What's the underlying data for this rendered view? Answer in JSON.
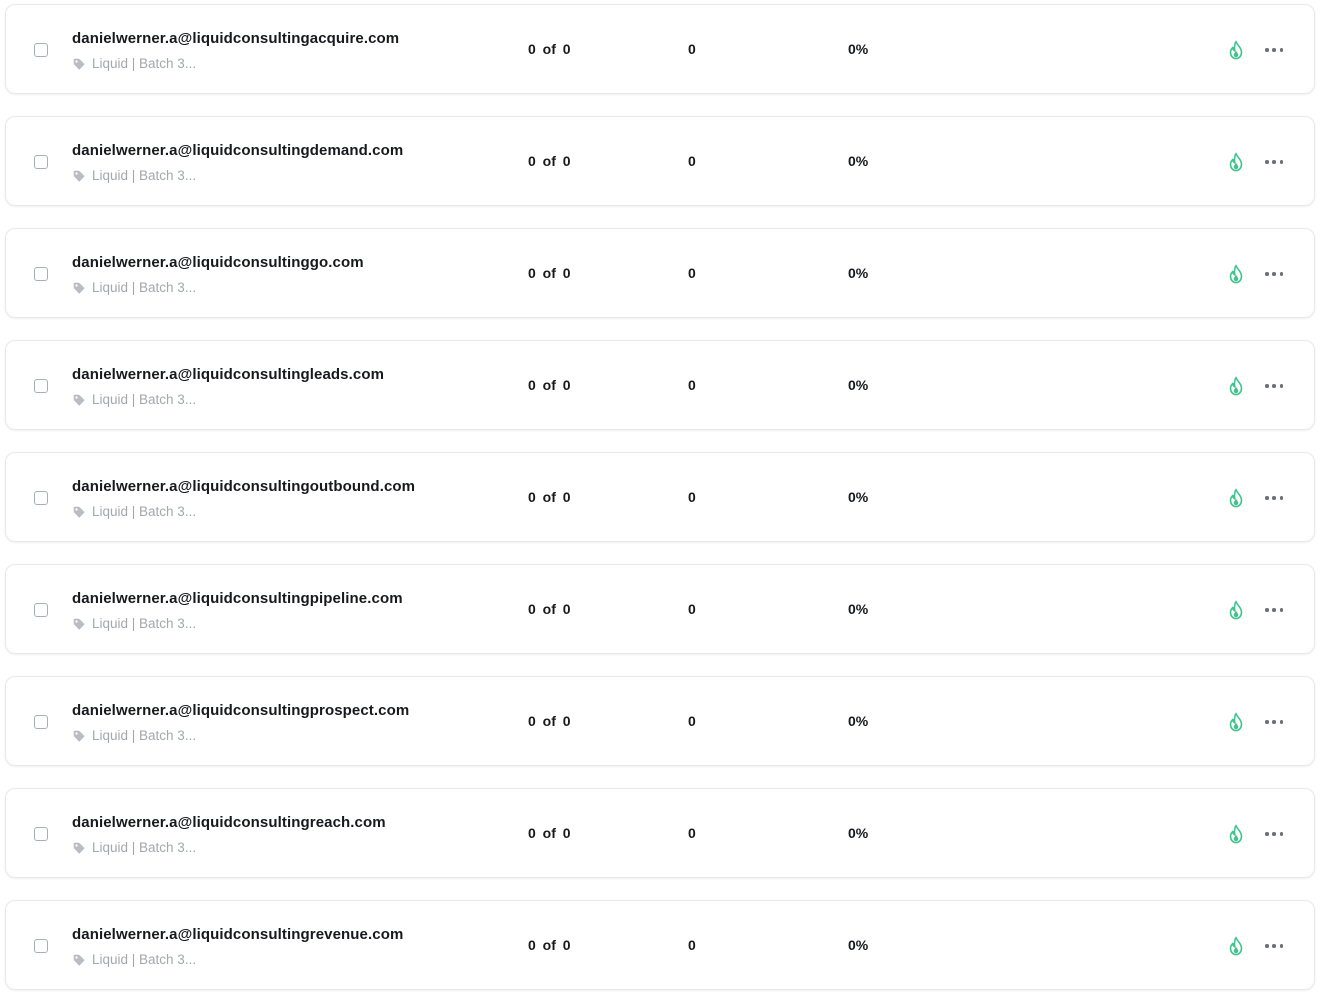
{
  "accent_color": "#3fc48c",
  "rows": [
    {
      "email": "danielwerner.a@liquidconsultingacquire.com",
      "tag": "Liquid | Batch 3...",
      "sent": "0 of 0",
      "count": "0",
      "percent": "0%"
    },
    {
      "email": "danielwerner.a@liquidconsultingdemand.com",
      "tag": "Liquid | Batch 3...",
      "sent": "0 of 0",
      "count": "0",
      "percent": "0%"
    },
    {
      "email": "danielwerner.a@liquidconsultinggo.com",
      "tag": "Liquid | Batch 3...",
      "sent": "0 of 0",
      "count": "0",
      "percent": "0%"
    },
    {
      "email": "danielwerner.a@liquidconsultingleads.com",
      "tag": "Liquid | Batch 3...",
      "sent": "0 of 0",
      "count": "0",
      "percent": "0%"
    },
    {
      "email": "danielwerner.a@liquidconsultingoutbound.com",
      "tag": "Liquid | Batch 3...",
      "sent": "0 of 0",
      "count": "0",
      "percent": "0%"
    },
    {
      "email": "danielwerner.a@liquidconsultingpipeline.com",
      "tag": "Liquid | Batch 3...",
      "sent": "0 of 0",
      "count": "0",
      "percent": "0%"
    },
    {
      "email": "danielwerner.a@liquidconsultingprospect.com",
      "tag": "Liquid | Batch 3...",
      "sent": "0 of 0",
      "count": "0",
      "percent": "0%"
    },
    {
      "email": "danielwerner.a@liquidconsultingreach.com",
      "tag": "Liquid | Batch 3...",
      "sent": "0 of 0",
      "count": "0",
      "percent": "0%"
    },
    {
      "email": "danielwerner.a@liquidconsultingrevenue.com",
      "tag": "Liquid | Batch 3...",
      "sent": "0 of 0",
      "count": "0",
      "percent": "0%"
    }
  ]
}
